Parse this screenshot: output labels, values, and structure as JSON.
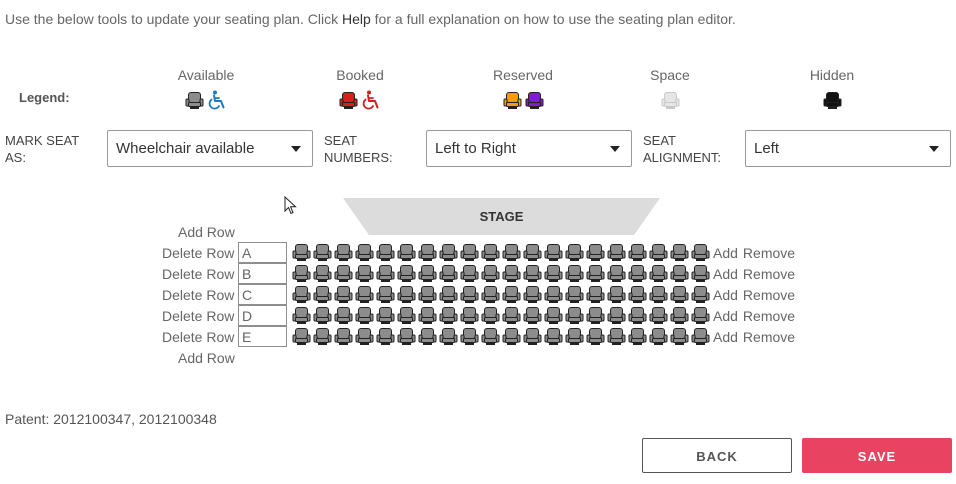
{
  "intro": {
    "before": "Use the below tools to update your seating plan. Click ",
    "help_link": "Help",
    "after": " for a full explanation on how to use the seating plan editor."
  },
  "legend": {
    "label": "Legend:",
    "items": [
      {
        "name": "Available",
        "icons": [
          "seat-available-icon",
          "wheelchair-icon"
        ],
        "colors": [
          "#8c8c8c",
          "#1a7ac8"
        ]
      },
      {
        "name": "Booked",
        "icons": [
          "seat-booked-icon",
          "wheelchair-icon"
        ],
        "colors": [
          "#d42020",
          "#d42020"
        ]
      },
      {
        "name": "Reserved",
        "icons": [
          "seat-reserved-icon",
          "seat-reserved-icon"
        ],
        "colors": [
          "#f0a000",
          "#7a1fd1"
        ]
      },
      {
        "name": "Space",
        "icons": [
          "seat-space-icon"
        ],
        "colors": [
          "#e6e6e6"
        ]
      },
      {
        "name": "Hidden",
        "icons": [
          "seat-hidden-icon"
        ],
        "colors": [
          "#111111"
        ]
      }
    ]
  },
  "controls": {
    "mark_seat": {
      "label_line1": "MARK SEAT",
      "label_line2": "AS:",
      "value": "Wheelchair available"
    },
    "seat_numbers": {
      "label_line1": "SEAT",
      "label_line2": "NUMBERS:",
      "value": "Left to Right"
    },
    "seat_alignment": {
      "label_line1": "SEAT",
      "label_line2": "ALIGNMENT:",
      "value": "Left"
    }
  },
  "stage": {
    "label": "STAGE",
    "color": "#dcdcdc"
  },
  "plan": {
    "add_row_label": "Add Row",
    "delete_row_label": "Delete Row",
    "add_label": "Add",
    "remove_label": "Remove",
    "seats_per_row": 20,
    "rows": [
      "A",
      "B",
      "C",
      "D",
      "E"
    ]
  },
  "patent": "Patent: 2012100347, 2012100348",
  "buttons": {
    "back": "BACK",
    "save": "SAVE"
  },
  "colors": {
    "save": "#e84361",
    "seat": "#8c8c8c"
  }
}
